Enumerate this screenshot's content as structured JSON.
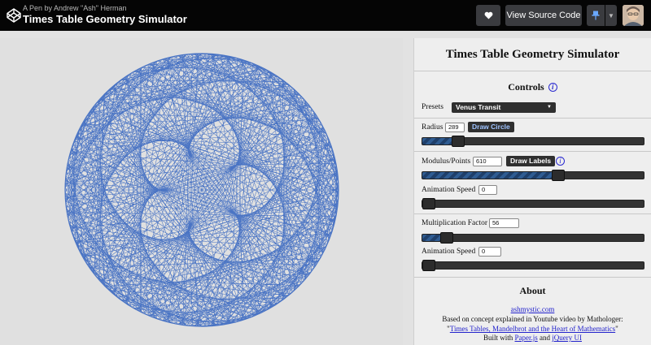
{
  "header": {
    "byline": "A Pen by Andrew \"Ash\" Herman",
    "title": "Times Table Geometry Simulator",
    "view_source_label": "View Source Code"
  },
  "panel": {
    "title": "Times Table Geometry Simulator",
    "controls_title": "Controls",
    "presets_label": "Presets",
    "preset_selected": "Venus Transit",
    "radius_label": "Radius",
    "radius_value": "289",
    "draw_circle_label": "Draw Circle",
    "radius_slider_fraction": 0.16,
    "modulus_label": "Modulus/Points",
    "modulus_value": "610",
    "draw_labels_label": "Draw Labels",
    "modulus_slider_fraction": 0.61,
    "mod_anim_label": "Animation Speed",
    "mod_anim_value": "0",
    "mod_anim_fraction": 0,
    "mult_label": "Multiplication Factor",
    "mult_value": "56",
    "mult_slider_fraction": 0.11,
    "mult_anim_label": "Animation Speed",
    "mult_anim_value": "0",
    "mult_anim_fraction": 0
  },
  "about": {
    "title": "About",
    "link": "ashmystic.com",
    "line1": "Based on concept explained in Youtube video by Mathologer:",
    "video_quote_open": "\"",
    "video_link": "Times Tables, Mandelbrot and the Heart of Mathematics",
    "video_quote_close": "\"",
    "built_prefix": "Built with ",
    "paper_link": "Paper.js",
    "built_and": " and ",
    "jquery_link": "jQuery UI"
  },
  "simulation": {
    "points": 610,
    "factor": 56,
    "stroke_color": "#4a74c4"
  },
  "colors": {
    "topbar": "#050505",
    "accent_slider": "#2f5c92"
  }
}
